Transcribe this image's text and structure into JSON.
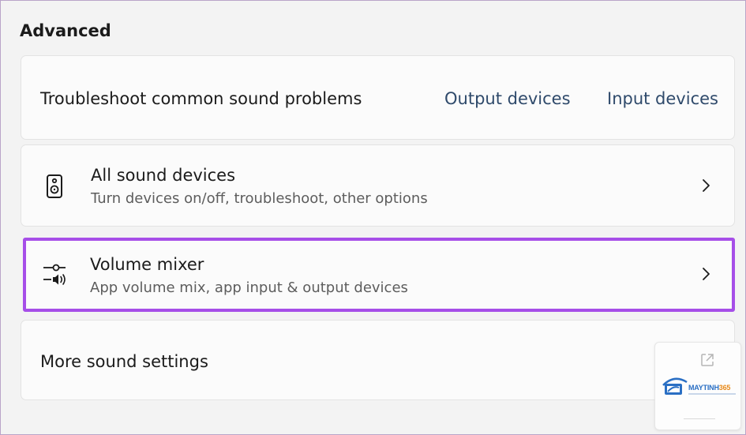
{
  "section": {
    "title": "Advanced"
  },
  "troubleshoot": {
    "label": "Troubleshoot common sound problems",
    "output_link": "Output devices",
    "input_link": "Input devices"
  },
  "all_sound_devices": {
    "title": "All sound devices",
    "subtitle": "Turn devices on/off, troubleshoot, other options",
    "icon": "speaker-icon"
  },
  "volume_mixer": {
    "title": "Volume mixer",
    "subtitle": "App volume mix, app input & output devices",
    "icon": "volume-mixer-icon",
    "highlight_color": "#a64ee8"
  },
  "more_sound_settings": {
    "title": "More sound settings",
    "icon": "external-link-icon"
  },
  "watermark": {
    "brand": "MAYTINH365"
  }
}
